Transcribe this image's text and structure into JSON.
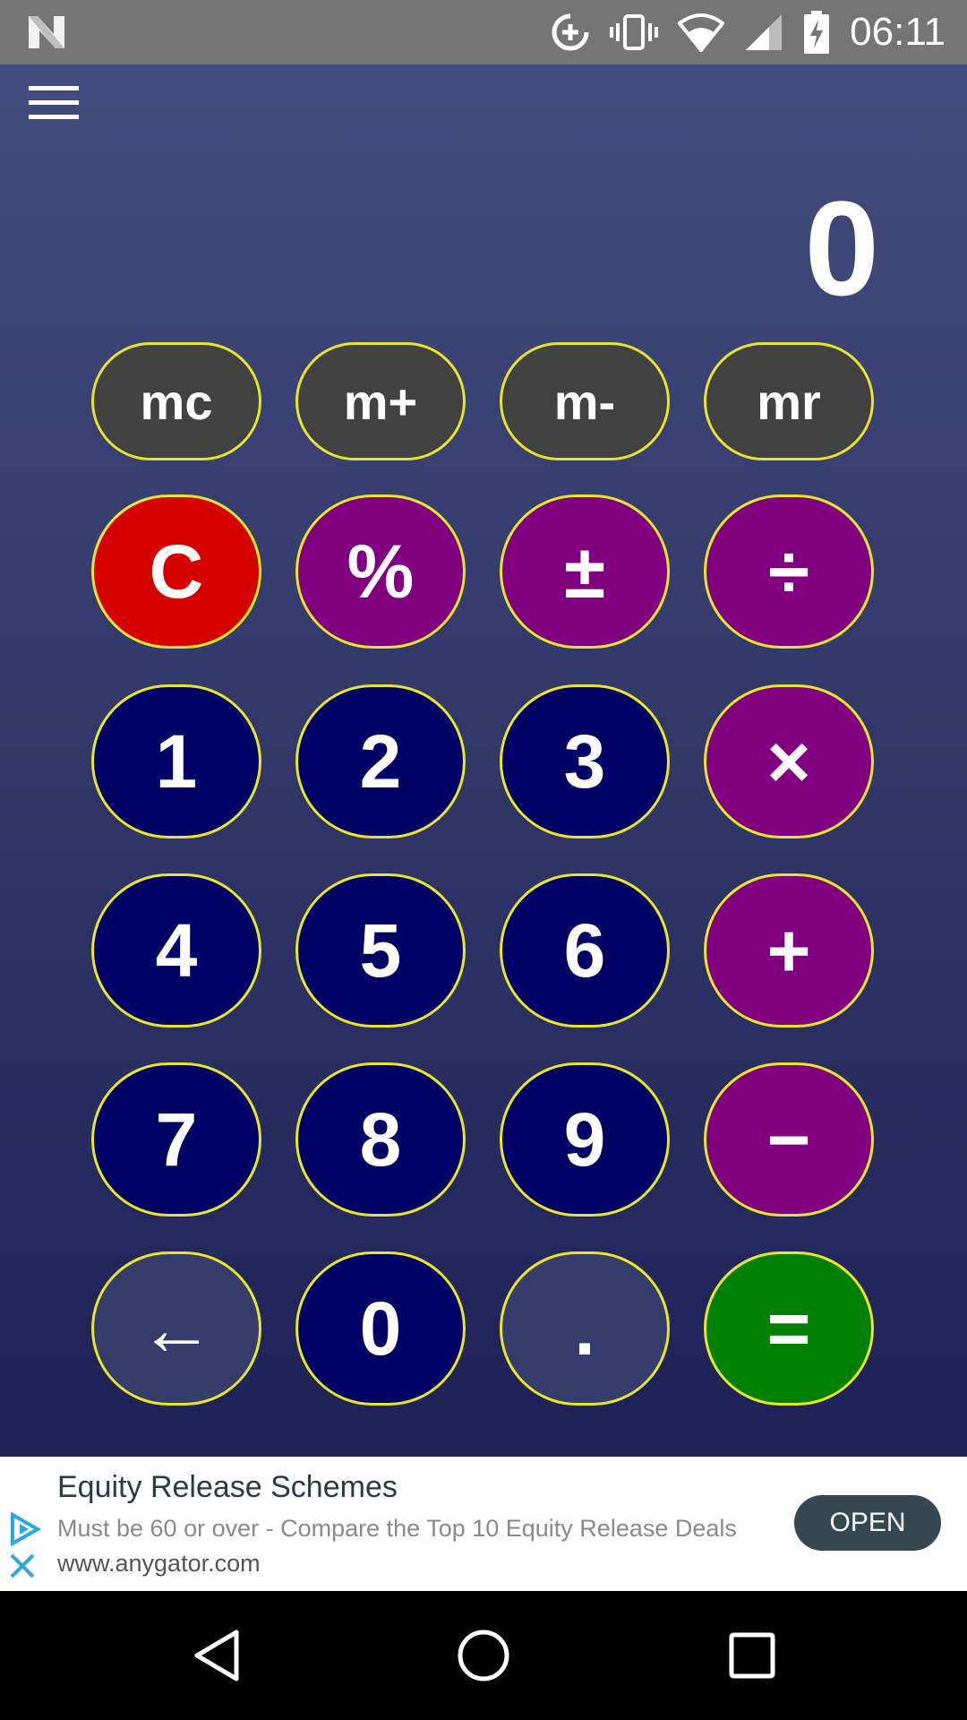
{
  "status_bar": {
    "time": "06:11",
    "icons": [
      "n-logo-icon",
      "data-saver-icon",
      "vibrate-icon",
      "wifi-icon",
      "cell-signal-icon",
      "battery-charging-icon"
    ]
  },
  "app": {
    "display": "0",
    "menu_icon": "hamburger-menu-icon",
    "memory_buttons": [
      "mc",
      "m+",
      "m-",
      "mr"
    ],
    "keys": {
      "clear": "C",
      "percent": "%",
      "plus_minus": "±",
      "divide": "÷",
      "one": "1",
      "two": "2",
      "three": "3",
      "multiply": "×",
      "four": "4",
      "five": "5",
      "six": "6",
      "plus": "+",
      "seven": "7",
      "eight": "8",
      "nine": "9",
      "minus": "−",
      "backspace": "←",
      "zero": "0",
      "decimal": ".",
      "equals": "="
    },
    "colors": {
      "border": "#e8e62a",
      "memory": "#424242",
      "clear": "#d50000",
      "operator": "#800080",
      "digit": "#010166",
      "aux": "#363c6c",
      "equals": "#008000"
    }
  },
  "ad": {
    "title": "Equity Release Schemes",
    "description": "Must be 60 or over - Compare the Top 10 Equity Release Deals",
    "url": "www.anygator.com",
    "button_label": "OPEN"
  },
  "nav_bar": {
    "icons": [
      "back-icon",
      "home-icon",
      "recents-icon"
    ]
  }
}
